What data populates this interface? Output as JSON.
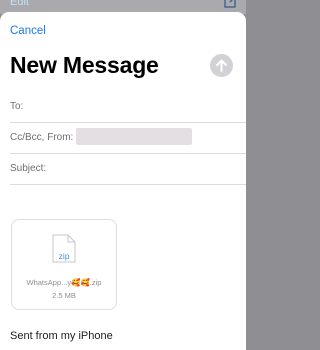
{
  "background": {
    "edit_label": "Edit"
  },
  "header": {
    "cancel_label": "Cancel",
    "title": "New Message"
  },
  "fields": {
    "to_label": "To:",
    "cc_from_label": "Cc/Bcc, From:",
    "subject_label": "Subject:"
  },
  "attachment": {
    "ext": "zip",
    "name": "WhatsApp...y🥰🥰.zip",
    "size": "2.5 MB"
  },
  "body": {
    "signature": "Sent from my iPhone"
  },
  "colors": {
    "accent": "#1a7ae8",
    "send_disabled": "#d1d1d6"
  }
}
